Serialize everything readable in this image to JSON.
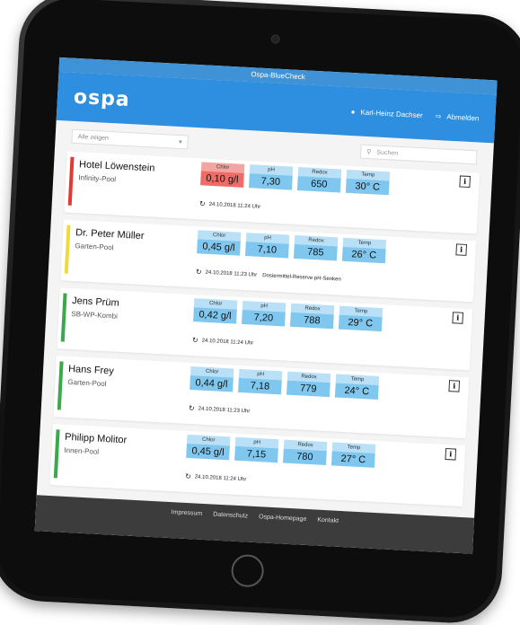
{
  "app": {
    "window_title": "Ospa-BlueCheck"
  },
  "header": {
    "logo": "ospa",
    "user_name": "Karl-Heinz Dachser",
    "logout_label": "Abmelden"
  },
  "filter": {
    "select_value": "Alle zeigen",
    "search_placeholder": "Suchen"
  },
  "metric_labels": {
    "chlor": "Chlor",
    "ph": "pH",
    "redox": "Redox",
    "temp": "Temp"
  },
  "info_glyph": "i",
  "pools": [
    {
      "name": "Hotel Löwenstein",
      "type": "Infinity-Pool",
      "status_color": "#e03a35",
      "chlor": "0,10 g/l",
      "chlor_alert": true,
      "ph": "7,30",
      "redox": "650",
      "temp": "30° C",
      "timestamp": "24.10.2018  11:24 Uhr",
      "note": ""
    },
    {
      "name": "Dr. Peter Müller",
      "type": "Garten-Pool",
      "status_color": "#f1d93c",
      "chlor": "0,45 g/l",
      "chlor_alert": false,
      "ph": "7,10",
      "redox": "785",
      "temp": "26° C",
      "timestamp": "24.10.2018  11:23 Uhr",
      "note": "Dosiermittel-Reserve pH-Senken"
    },
    {
      "name": "Jens Prüm",
      "type": "SB-WP-Kombi",
      "status_color": "#3aa84b",
      "chlor": "0,42 g/l",
      "chlor_alert": false,
      "ph": "7,20",
      "redox": "788",
      "temp": "29° C",
      "timestamp": "24.10.2018  11:24 Uhr",
      "note": ""
    },
    {
      "name": "Hans Frey",
      "type": "Garten-Pool",
      "status_color": "#3aa84b",
      "chlor": "0,44 g/l",
      "chlor_alert": false,
      "ph": "7,18",
      "redox": "779",
      "temp": "24° C",
      "timestamp": "24.10.2018  11:23 Uhr",
      "note": ""
    },
    {
      "name": "Philipp Molitor",
      "type": "Innen-Pool",
      "status_color": "#3aa84b",
      "chlor": "0,45 g/l",
      "chlor_alert": false,
      "ph": "7,15",
      "redox": "780",
      "temp": "27° C",
      "timestamp": "24.10.2018  11:24 Uhr",
      "note": ""
    }
  ],
  "footer": {
    "links": [
      "Impressum",
      "Datenschutz",
      "Ospa-Homepage",
      "Kontakt"
    ]
  },
  "icons": {
    "user": "user-icon",
    "logout": "logout-icon",
    "search": "search-icon",
    "refresh": "refresh-icon",
    "dropdown": "chevron-down-icon"
  }
}
